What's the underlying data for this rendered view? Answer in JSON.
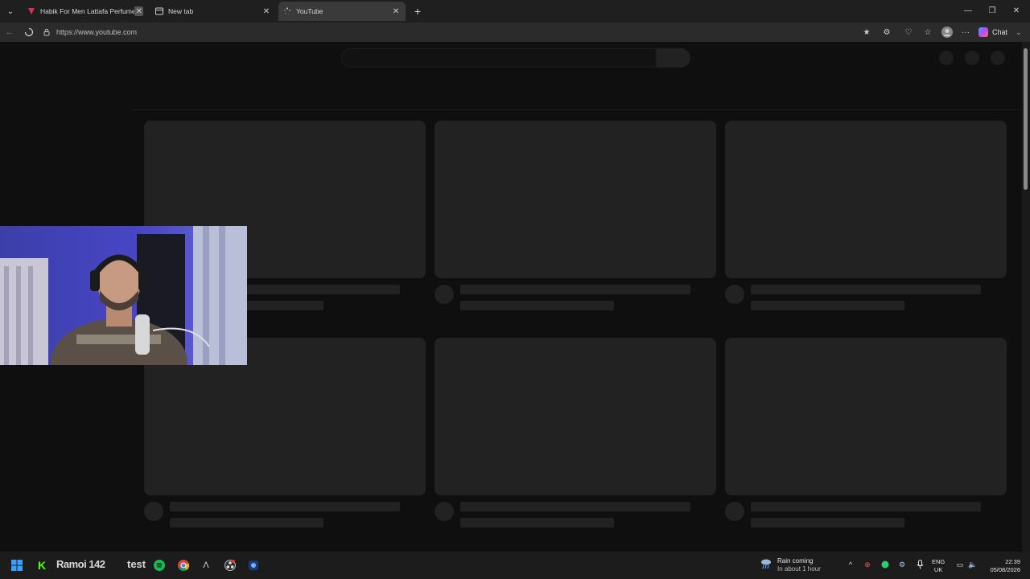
{
  "browser": {
    "tabs": [
      {
        "title": "Habik For Men Lattafa Perfumes co",
        "active": false
      },
      {
        "title": "New tab",
        "active": false
      },
      {
        "title": "YouTube",
        "active": true
      }
    ],
    "url": "https://www.youtube.com",
    "chat_label": "Chat"
  },
  "taskbar": {
    "pinned_text_1": "Ramoi 142",
    "pinned_text_2": "test",
    "weather_title": "Rain coming",
    "weather_subtitle": "In about 1 hour",
    "lang_1": "ENG",
    "lang_2": "UK",
    "time": "22:39",
    "date": "05/08/2026"
  },
  "colors": {
    "page_bg": "#0f0f0f",
    "skeleton": "#222222",
    "taskbar_bg": "#1c1c1c",
    "tab_active_bg": "#3a3a3a"
  }
}
